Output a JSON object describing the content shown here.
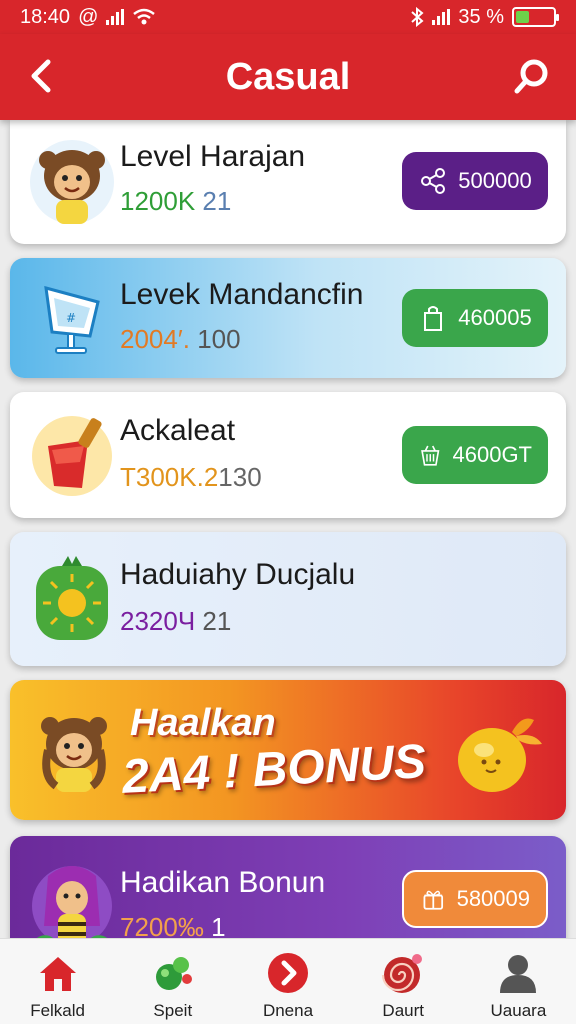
{
  "status": {
    "time": "18:40",
    "battery": "35 %",
    "battery_level": 0.35
  },
  "header": {
    "title": "Casual"
  },
  "items": [
    {
      "name": "Level Harajan",
      "score_a": "1200K",
      "score_b": "21",
      "button": "500000",
      "button_icon": "share-icon",
      "colors": {
        "button": "#5b1f87",
        "score_a": "#2f9e37",
        "score_b": "#5a7fb0"
      }
    },
    {
      "name": "Levek Mandancfin",
      "score_a": "2004′.",
      "score_b": "100",
      "button": "460005",
      "button_icon": "bag-icon",
      "colors": {
        "button": "#3aa64b",
        "score_a": "#e27a24",
        "score_b": "#555"
      }
    },
    {
      "name": "Ackaleat",
      "score_a": "T300K.2",
      "score_b": "130",
      "button": "4600GT",
      "button_icon": "basket-icon",
      "colors": {
        "button": "#3aa64b",
        "score_a": "#e2941c",
        "score_b": "#666"
      }
    },
    {
      "name": "Haduiahy Ducjalu",
      "score_a": "2320Ч",
      "score_b": "21",
      "colors": {
        "score_a": "#7a1fa0",
        "score_b": "#555"
      }
    },
    {
      "bonus_line1": "Haalkan",
      "bonus_line2": "2A4 ! BONUS"
    },
    {
      "name": "Hadikan Bonun",
      "score_a": "7200‰",
      "score_b": "1",
      "button": "580009",
      "button_icon": "gift-icon",
      "colors": {
        "button": "#f08a3a",
        "score_a": "#f2a14b",
        "score_b": "#fff"
      }
    }
  ],
  "nav": [
    {
      "label": "Felkald",
      "icon": "home-icon",
      "color": "#d8262b"
    },
    {
      "label": "Speіt",
      "icon": "game-balls-icon",
      "color": "#2e9b3a"
    },
    {
      "label": "Dnena",
      "icon": "play-arrow-icon",
      "color": "#d8262b"
    },
    {
      "label": "Daurt",
      "icon": "spiral-icon",
      "color": "#c22a2a"
    },
    {
      "label": "Uauara",
      "icon": "user-icon",
      "color": "#555"
    }
  ]
}
